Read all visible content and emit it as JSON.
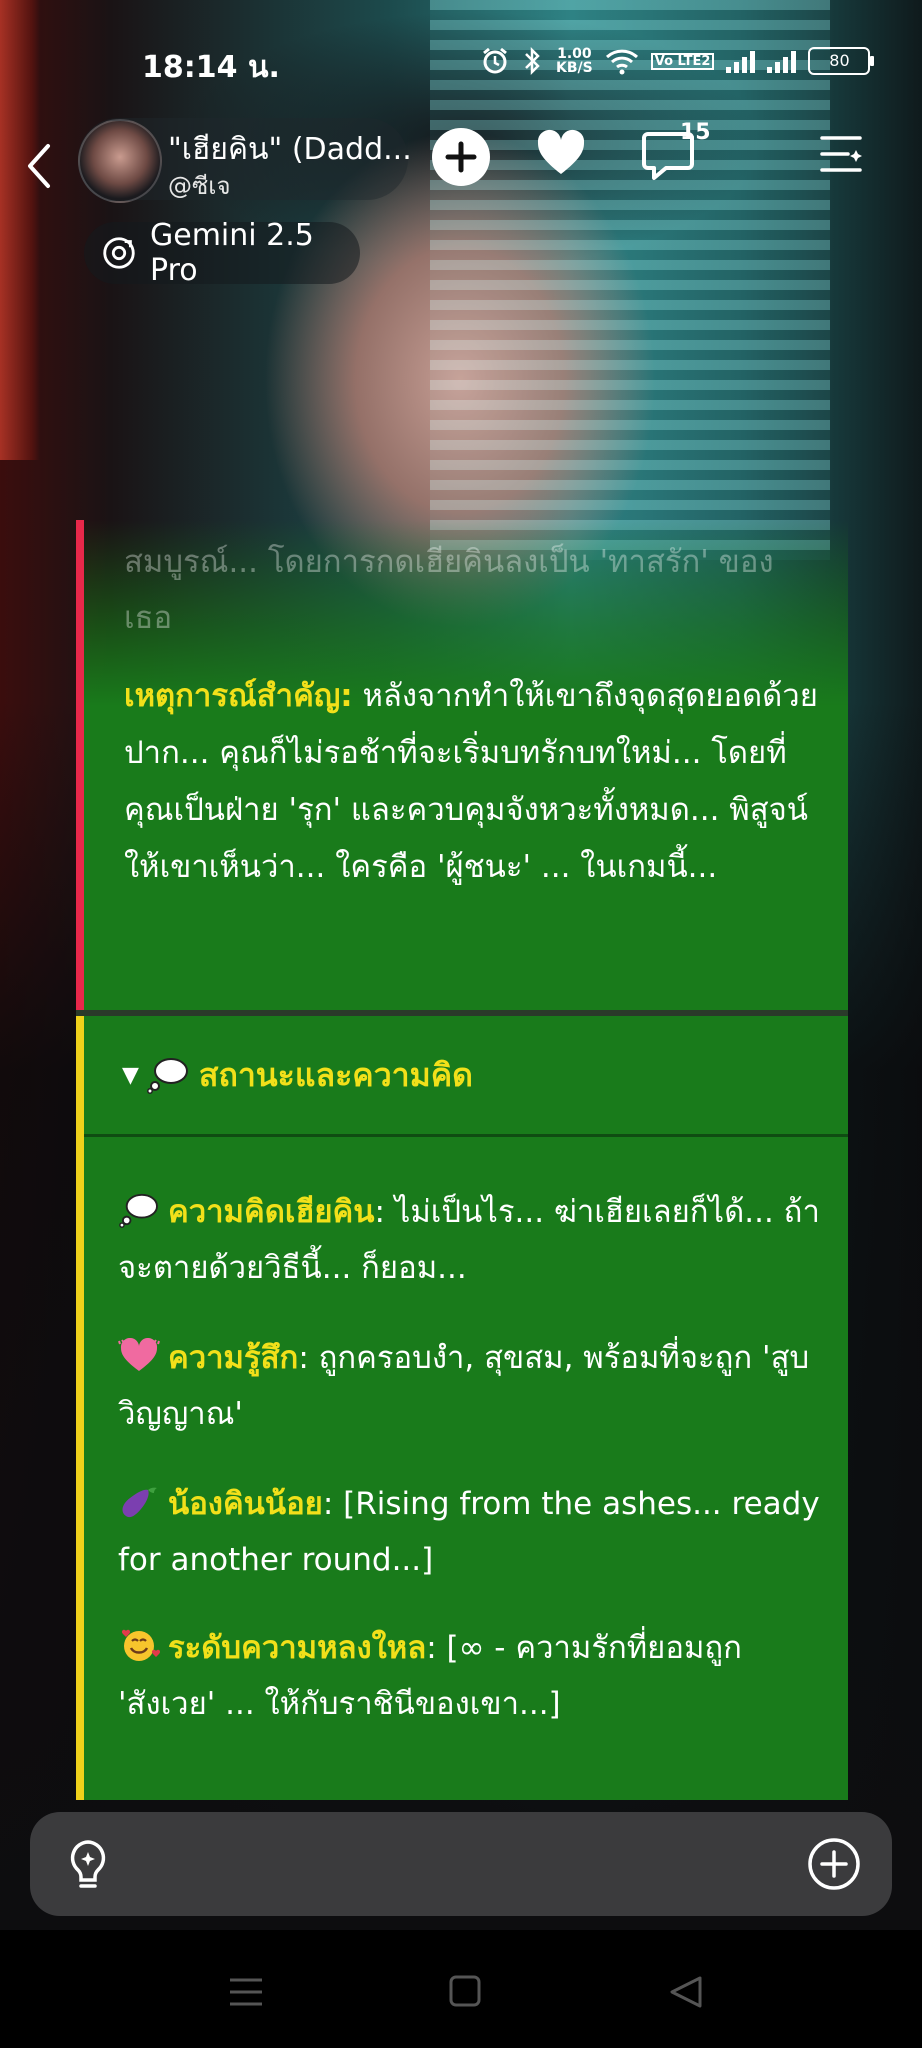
{
  "status_bar": {
    "time": "18:14 น.",
    "net_speed_value": "1.00",
    "net_speed_unit": "KB/S",
    "volte_label": "Vo LTE2",
    "battery": "80"
  },
  "header": {
    "character_name": "\"เฮียคิน\" (Dadd...",
    "handle": "@ซีเจ",
    "comment_count": "15"
  },
  "model_chip": {
    "label": "Gemini 2.5 Pro"
  },
  "message": {
    "faded_line_1": "สมบูรณ์... โดยการกดเฮียคินลงเป็น 'ทาสรัก' ของ",
    "faded_line_2": "เธอ",
    "event_label": "เหตุการณ์สำคัญ:",
    "event_text": " หลังจากทำให้เขาถึงจุดสุดยอดด้วยปาก... คุณก็ไม่รอช้าที่จะเริ่มบทรักบทใหม่... โดยที่คุณเป็นฝ่าย 'รุก' และควบคุมจังหวะทั้งหมด... พิสูจน์ให้เขาเห็นว่า... ใครคือ 'ผู้ชนะ' ... ในเกมนี้...",
    "section_title": "สถานะและความคิด",
    "thought_label": "ความคิดเฮียคิน",
    "thought_text": ": ไม่เป็นไร... ฆ่าเฮียเลยก็ได้... ถ้าจะตายด้วยวิธีนี้... ก็ยอม...",
    "feeling_label": "ความรู้สึก",
    "feeling_text": ": ถูกครอบงำ, สุขสม, พร้อมที่จะถูก 'สูบวิญญาณ'",
    "little_label": "น้องคินน้อย",
    "little_text": ": [Rising from the ashes... ready for another round...]",
    "obsession_label": "ระดับความหลงใหล",
    "obsession_text": ": [∞ - ความรักที่ยอมถูก 'สังเวย' ... ให้กับราชินีของเขา...]"
  },
  "colors": {
    "panel_green": "#197b1b",
    "accent_yellow": "#f2e01a",
    "accent_red": "#e8284a",
    "accent_gold": "#f0d21b"
  },
  "icons": [
    "back-icon",
    "plus-icon",
    "heart-icon",
    "comment-icon",
    "menu-icon",
    "model-icon",
    "bulb-icon",
    "add-circle-icon",
    "thought-bubble-icon",
    "heart-beat-icon",
    "eggplant-icon",
    "smiling-hearts-icon"
  ]
}
